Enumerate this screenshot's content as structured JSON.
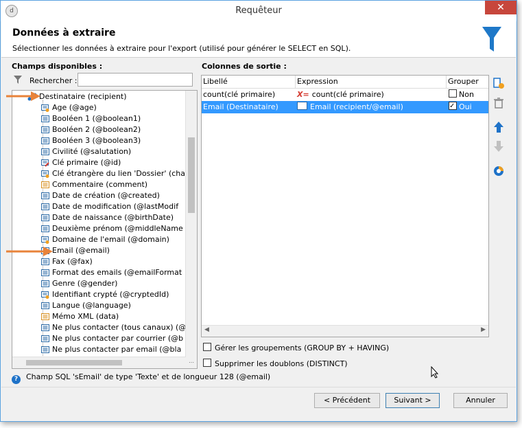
{
  "window": {
    "title": "Requêteur",
    "close_glyph": "✕",
    "app_icon": "d"
  },
  "header": {
    "title": "Données à extraire",
    "subtitle": "Sélectionner les données à extraire pour l'export (utilisé pour générer le SELECT en SQL).",
    "icon": "funnel-icon",
    "accent": "#1e78c8"
  },
  "left_panel": {
    "title": "Champs disponibles :",
    "search_label": "Rechercher :",
    "search_value": "",
    "tree": [
      {
        "label": "Destinataire (recipient)",
        "icon": "link-node-icon",
        "level": 0
      },
      {
        "label": "Age (@age)",
        "icon": "computed-field-icon",
        "level": 1
      },
      {
        "label": "Booléen 1 (@boolean1)",
        "icon": "field-icon",
        "level": 1
      },
      {
        "label": "Booléen 2 (@boolean2)",
        "icon": "field-icon",
        "level": 1
      },
      {
        "label": "Booléen 3 (@boolean3)",
        "icon": "field-icon",
        "level": 1
      },
      {
        "label": "Civilité (@salutation)",
        "icon": "field-icon",
        "level": 1
      },
      {
        "label": "Clé primaire (@id)",
        "icon": "key-field-icon",
        "level": 1
      },
      {
        "label": "Clé étrangère du lien 'Dossier' (cha",
        "icon": "computed-field-icon",
        "level": 1
      },
      {
        "label": "Commentaire (comment)",
        "icon": "memo-field-icon",
        "level": 1
      },
      {
        "label": "Date de création (@created)",
        "icon": "field-icon",
        "level": 1
      },
      {
        "label": "Date de modification (@lastModif",
        "icon": "field-icon",
        "level": 1
      },
      {
        "label": "Date de naissance (@birthDate)",
        "icon": "field-icon",
        "level": 1
      },
      {
        "label": "Deuxième prénom (@middleName",
        "icon": "field-icon",
        "level": 1
      },
      {
        "label": "Domaine de l'email (@domain)",
        "icon": "computed-field-icon",
        "level": 1
      },
      {
        "label": "Email (@email)",
        "icon": "field-icon",
        "level": 1
      },
      {
        "label": "Fax (@fax)",
        "icon": "field-icon",
        "level": 1
      },
      {
        "label": "Format des emails (@emailFormat",
        "icon": "field-icon",
        "level": 1
      },
      {
        "label": "Genre (@gender)",
        "icon": "field-icon",
        "level": 1
      },
      {
        "label": "Identifiant crypté (@cryptedId)",
        "icon": "computed-field-icon",
        "level": 1
      },
      {
        "label": "Langue (@language)",
        "icon": "field-icon",
        "level": 1
      },
      {
        "label": "Mémo XML (data)",
        "icon": "memo-field-icon",
        "level": 1
      },
      {
        "label": "Ne plus contacter (tous canaux) (@",
        "icon": "field-icon",
        "level": 1
      },
      {
        "label": "Ne plus contacter par courrier (@b",
        "icon": "field-icon",
        "level": 1
      },
      {
        "label": "Ne plus contacter par email (@bla",
        "icon": "field-icon",
        "level": 1
      }
    ]
  },
  "right_panel": {
    "title": "Colonnes de sortie :",
    "columns": [
      "Libellé",
      "Expression",
      "Grouper"
    ],
    "rows": [
      {
        "label": "count(clé primaire)",
        "expr_icon": "aggregate-icon",
        "expression": "count(clé primaire)",
        "group_checked": false,
        "group_label": "Non",
        "selected": false
      },
      {
        "label": "Email (Destinataire)",
        "expr_icon": "field-icon",
        "expression": "Email (recipient/@email)",
        "group_checked": true,
        "group_label": "Oui",
        "selected": true
      }
    ],
    "options": [
      {
        "label": "Gérer les groupements (GROUP BY + HAVING)",
        "checked": false
      },
      {
        "label": "Supprimer les doublons (DISTINCT)",
        "checked": false
      }
    ],
    "side_buttons": [
      "add-column-icon",
      "delete-icon",
      "move-up-icon",
      "move-down-icon",
      "distribution-icon"
    ]
  },
  "help_text": "Champ SQL 'sEmail' de type 'Texte' et de longueur 128 (@email)",
  "buttons": {
    "previous": "< Précédent",
    "next": "Suivant >",
    "cancel": "Annuler"
  },
  "colors": {
    "selection": "#3399ff",
    "arrow": "#e8833a",
    "close": "#c7463c"
  }
}
